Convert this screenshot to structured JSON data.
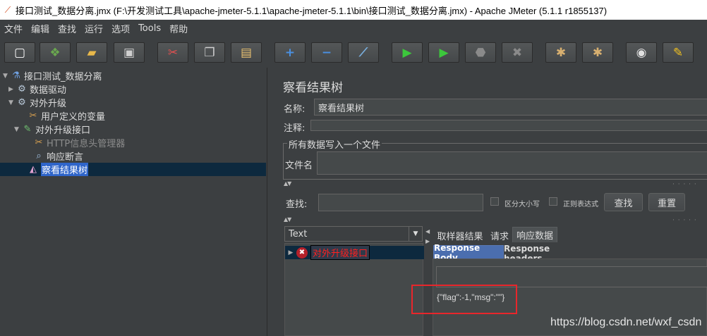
{
  "window": {
    "title": "接口测试_数据分离.jmx (F:\\开发测试工具\\apache-jmeter-5.1.1\\apache-jmeter-5.1.1\\bin\\接口测试_数据分离.jmx) - Apache JMeter (5.1.1 r1855137)"
  },
  "menu": [
    "文件",
    "编辑",
    "查找",
    "运行",
    "选项",
    "Tools",
    "帮助"
  ],
  "toolbar": [
    {
      "icon": "new-icon",
      "glyph": "▢",
      "color": "#ffffff"
    },
    {
      "icon": "templates-icon",
      "glyph": "❖",
      "color": "#6aa84f"
    },
    {
      "icon": "open-icon",
      "glyph": "▰",
      "color": "#e8b84a"
    },
    {
      "icon": "save-icon",
      "glyph": "▣",
      "color": "#cfcfcf"
    },
    {
      "icon": "cut-icon",
      "glyph": "✂",
      "color": "#e05050"
    },
    {
      "icon": "copy-icon",
      "glyph": "❐",
      "color": "#d0d0d0"
    },
    {
      "icon": "paste-icon",
      "glyph": "▤",
      "color": "#e8c070"
    },
    {
      "icon": "expand-icon",
      "glyph": "+",
      "color": "#4a90e2"
    },
    {
      "icon": "collapse-icon",
      "glyph": "−",
      "color": "#4a90e2"
    },
    {
      "icon": "toggle-icon",
      "glyph": "⟋",
      "color": "#7ab0e0"
    },
    {
      "icon": "start-icon",
      "glyph": "▶",
      "color": "#3cc83c"
    },
    {
      "icon": "start-no-pause-icon",
      "glyph": "▶",
      "color": "#3cc83c"
    },
    {
      "icon": "stop-icon",
      "glyph": "⬣",
      "color": "#8a8a8a"
    },
    {
      "icon": "shutdown-icon",
      "glyph": "✖",
      "color": "#8a8a8a"
    },
    {
      "icon": "clear-icon",
      "glyph": "✱",
      "color": "#d8b070"
    },
    {
      "icon": "clear-all-icon",
      "glyph": "✱",
      "color": "#d8b070"
    },
    {
      "icon": "search-icon",
      "glyph": "◉",
      "color": "#e0e0e0"
    },
    {
      "icon": "reset-search-icon",
      "glyph": "✎",
      "color": "#f0c020"
    }
  ],
  "tree": {
    "items": [
      {
        "label": "接口测试_数据分离",
        "icon": "test-plan-icon",
        "glyph": "⚗",
        "color": "#6fa0e0",
        "arrow": "▼"
      },
      {
        "label": "数据驱动",
        "icon": "thread-group-icon",
        "glyph": "⚙",
        "color": "#b8c8d8",
        "arrow": "▶"
      },
      {
        "label": "对外升级",
        "icon": "thread-group-icon",
        "glyph": "⚙",
        "color": "#b8c8d8",
        "arrow": "▼"
      },
      {
        "label": "用户定义的变量",
        "icon": "config-element-icon",
        "glyph": "✂",
        "color": "#d8a050",
        "arrow": ""
      },
      {
        "label": "对外升级接口",
        "icon": "sampler-icon",
        "glyph": "✎",
        "color": "#70c070",
        "arrow": "▼"
      },
      {
        "label": "HTTP信息头管理器",
        "icon": "config-element-icon",
        "glyph": "✂",
        "color": "#d8a050",
        "arrow": ""
      },
      {
        "label": "响应断言",
        "icon": "assertion-icon",
        "glyph": "⌕",
        "color": "#a0c0e0",
        "arrow": ""
      },
      {
        "label": "察看结果树",
        "icon": "listener-icon",
        "glyph": "◭",
        "color": "#e0a0d0",
        "arrow": ""
      }
    ]
  },
  "panel": {
    "title": "察看结果树",
    "name_label": "名称:",
    "name_value": "察看结果树",
    "comment_label": "注释:",
    "comment_value": "",
    "group_title": "所有数据写入一个文件",
    "filename_label": "文件名",
    "filename_value": "",
    "search_label": "查找:",
    "search_value": "",
    "case_sensitive_label": "区分大小写",
    "regex_label": "正则表达式",
    "search_button": "查找",
    "reset_button": "重置",
    "renderer": "Text",
    "tabs": [
      "取样器结果",
      "请求",
      "响应数据"
    ],
    "subtabs": [
      "Response Body",
      "Response headers"
    ],
    "result_item": "对外升级接口",
    "response_body": "{\"flag\":-1,\"msg\":\"\"}"
  },
  "watermark": "https://blog.csdn.net/wxf_csdn"
}
